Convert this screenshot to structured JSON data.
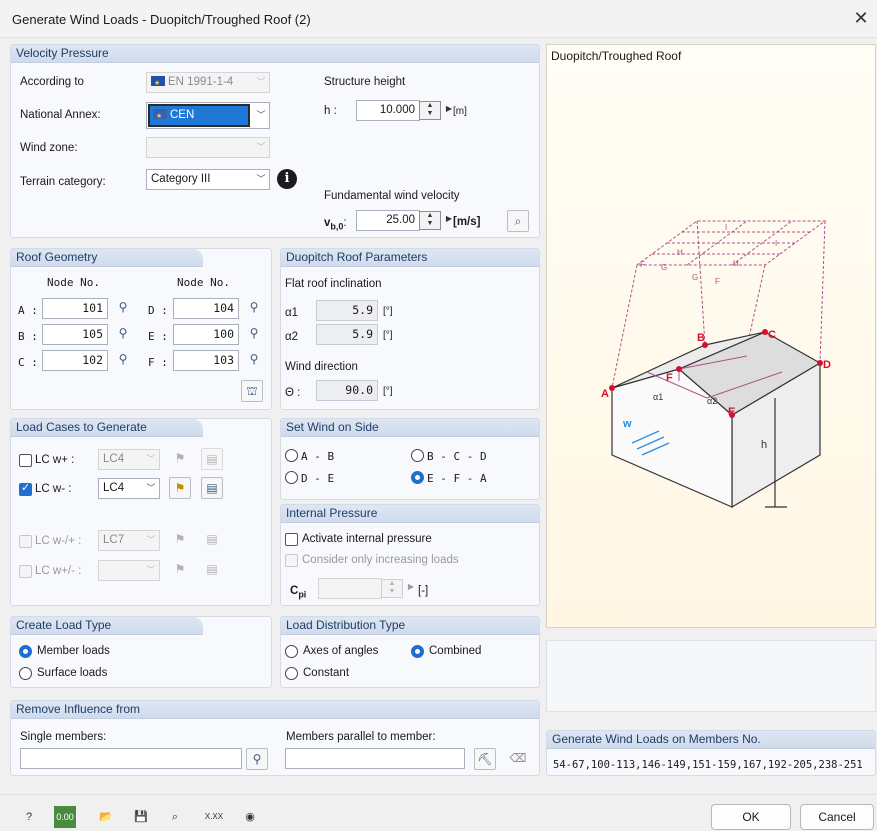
{
  "window": {
    "title": "Generate Wind Loads  -  Duopitch/Troughed Roof  (2)",
    "close": "✕"
  },
  "velocity": {
    "header": "Velocity Pressure",
    "according_label": "According to",
    "according_value": "EN 1991-1-4",
    "annex_label": "National Annex:",
    "annex_value": "CEN",
    "zone_label": "Wind zone:",
    "zone_value": "",
    "terrain_label": "Terrain category:",
    "terrain_value": "Category III",
    "height_title": "Structure height",
    "h_label": "h :",
    "h_value": "10.000",
    "h_unit": "[m]",
    "fund_title": "Fundamental wind velocity",
    "vb_label": "v",
    "vb_sub": "b,0",
    "vb_colon": ":",
    "vb_value": "25.00",
    "vb_unit": "[m/s]"
  },
  "roof": {
    "header": "Roof Geometry",
    "node_col1": "Node No.",
    "node_col2": "Node No.",
    "rows": [
      {
        "l1": "A :",
        "v1": "101",
        "l2": "D :",
        "v2": "104"
      },
      {
        "l1": "B :",
        "v1": "105",
        "l2": "E :",
        "v2": "100"
      },
      {
        "l1": "C :",
        "v1": "102",
        "l2": "F :",
        "v2": "103"
      }
    ]
  },
  "params": {
    "header": "Duopitch Roof Parameters",
    "flat_label": "Flat roof inclination",
    "a1_label": "α1",
    "a1_value": "5.9",
    "a1_unit": "[°]",
    "a2_label": "α2",
    "a2_value": "5.9",
    "a2_unit": "[°]",
    "dir_label": "Wind direction",
    "theta_label": "Θ :",
    "theta_value": "90.0",
    "theta_unit": "[°]"
  },
  "loadcases": {
    "header": "Load Cases to Generate",
    "items": [
      {
        "label": "LC w+ :",
        "value": "LC4"
      },
      {
        "label": "LC w- :",
        "value": "LC4"
      },
      {
        "label": "LC w-/+ :",
        "value": "LC7"
      },
      {
        "label": "LC w+/- :",
        "value": ""
      }
    ]
  },
  "side": {
    "header": "Set Wind on Side",
    "opt1": "A - B",
    "opt2": "B - C - D",
    "opt3": "D - E",
    "opt4": "E - F - A"
  },
  "internal": {
    "header": "Internal Pressure",
    "activate": "Activate internal pressure",
    "increasing": "Consider only increasing loads",
    "cpi_label": "C",
    "cpi_sub": "pi",
    "cpi_unit": "[-]"
  },
  "loadtype": {
    "header": "Create Load Type",
    "opt1": "Member loads",
    "opt2": "Surface loads"
  },
  "distribution": {
    "header": "Load Distribution Type",
    "opt1": "Axes of angles",
    "opt2": "Combined",
    "opt3": "Constant"
  },
  "remove": {
    "header": "Remove Influence from",
    "single": "Single members:",
    "parallel": "Members parallel to member:"
  },
  "preview": {
    "title": "Duopitch/Troughed Roof",
    "labels": {
      "A": "A",
      "B": "B",
      "C": "C",
      "D": "D",
      "E": "E",
      "F": "F",
      "h": "h",
      "w": "w",
      "a1": "α1",
      "a2": "α2",
      "zI": "I",
      "zH": "H",
      "zF": "F",
      "zG": "G"
    }
  },
  "members": {
    "header": "Generate Wind Loads on Members No.",
    "value": "54-67,100-113,146-149,151-159,167,192-205,238-251"
  },
  "footer": {
    "zero_label": "0.00",
    "xx_label": "X.XX",
    "ok": "OK",
    "cancel": "Cancel"
  },
  "colors": {
    "accent": "#1e6fd1",
    "header_blue": "#cfdbec",
    "zone_pink": "#b0508a",
    "marker_red": "#d6102c"
  }
}
